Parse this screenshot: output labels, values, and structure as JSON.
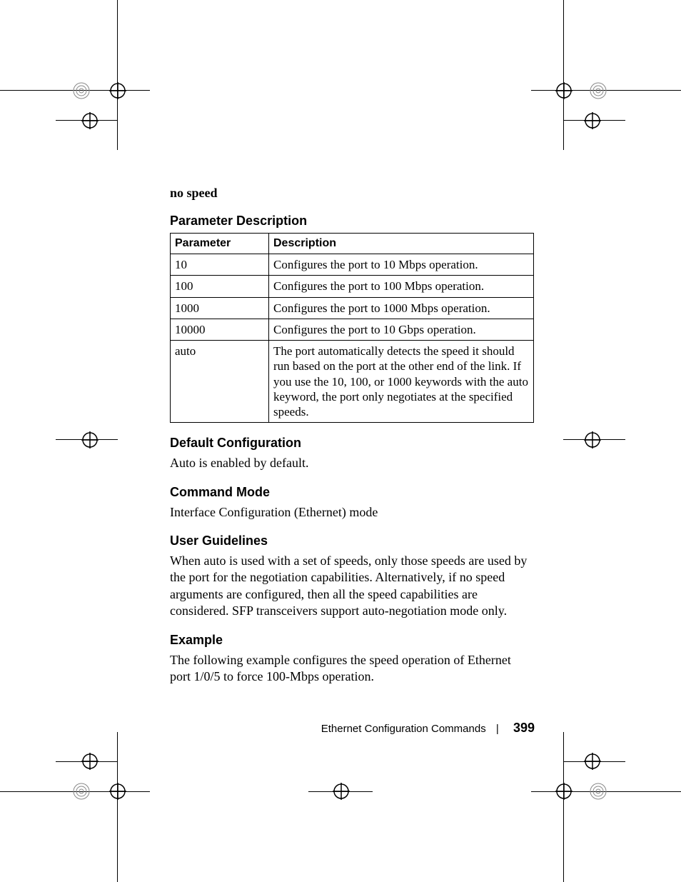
{
  "syntax_line": "no speed",
  "sections": {
    "param_desc": {
      "heading": "Parameter Description",
      "table": {
        "head": {
          "parameter": "Parameter",
          "description": "Description"
        },
        "rows": [
          {
            "param": "10",
            "desc": "Configures the port to 10 Mbps operation."
          },
          {
            "param": "100",
            "desc": "Configures the port to 100 Mbps operation."
          },
          {
            "param": "1000",
            "desc": "Configures the port to 1000 Mbps operation."
          },
          {
            "param": "10000",
            "desc": "Configures the port to 10 Gbps operation."
          },
          {
            "param": "auto",
            "desc": "The port automatically detects the speed it should run based on the port at the other end of the link. If you use the 10, 100, or 1000 keywords with the auto keyword, the port only negotiates at the specified speeds."
          }
        ]
      }
    },
    "default_config": {
      "heading": "Default Configuration",
      "body": "Auto is enabled by default."
    },
    "command_mode": {
      "heading": "Command Mode",
      "body": "Interface Configuration (Ethernet) mode"
    },
    "user_guidelines": {
      "heading": "User Guidelines",
      "body": "When auto is used with a set of speeds, only those speeds are used by the port for the negotiation capabilities. Alternatively, if no speed arguments are configured, then all the speed capabilities are considered. SFP transceivers support auto-negotiation mode only."
    },
    "example": {
      "heading": "Example",
      "body": "The following example configures the speed operation of Ethernet port 1/0/5 to force 100-Mbps operation."
    }
  },
  "footer": {
    "section_title": "Ethernet Configuration Commands",
    "separator": "|",
    "page_number": "399"
  }
}
